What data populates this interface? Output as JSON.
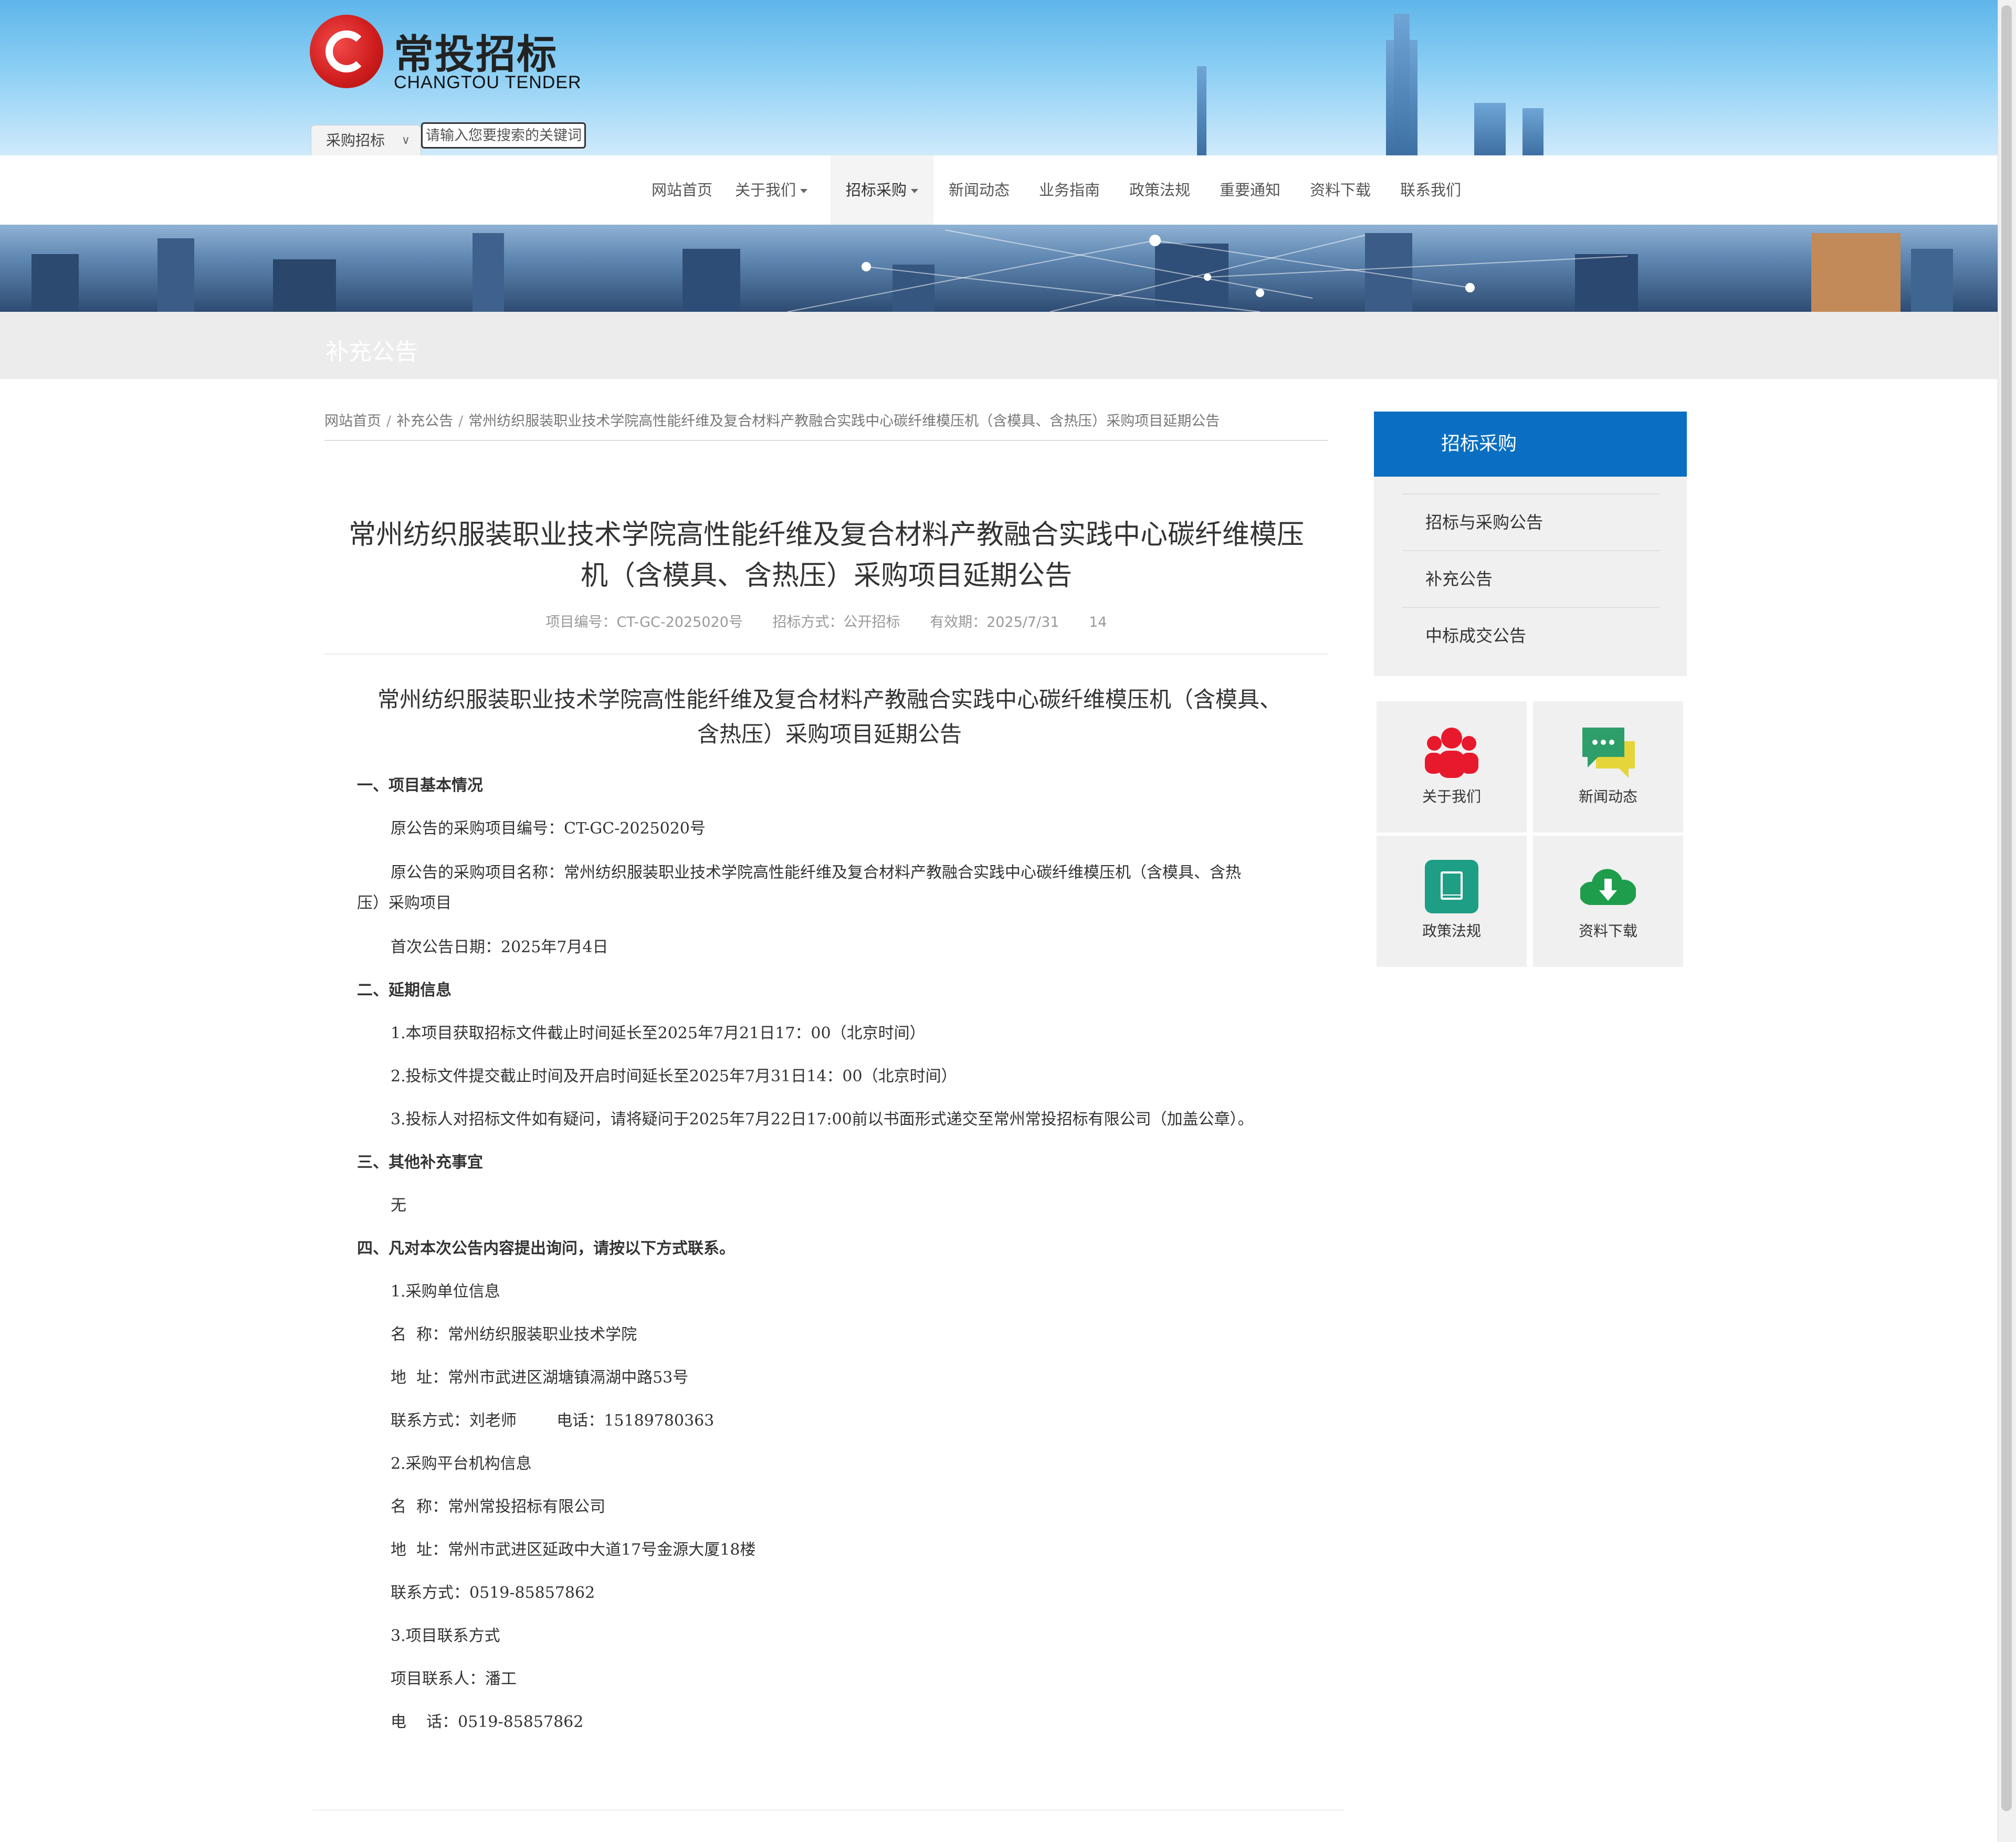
{
  "logo": {
    "cn": "常投招标",
    "en": "CHANGTOU TENDER"
  },
  "search": {
    "category": "采购招标",
    "placeholder": "请输入您要搜索的关键词"
  },
  "nav": {
    "items": [
      "网站首页",
      "关于我们",
      "招标采购",
      "新闻动态",
      "业务指南",
      "政策法规",
      "重要通知",
      "资料下载",
      "联系我们"
    ]
  },
  "page_title": "补充公告",
  "breadcrumb": [
    "网站首页",
    "补充公告",
    "常州纺织服装职业技术学院高性能纤维及复合材料产教融合实践中心碳纤维模压机（含模具、含热压）采购项目延期公告"
  ],
  "article": {
    "title_line1": "常州纺织服装职业技术学院高性能纤维及复合材料产教融合实践中心碳纤维模压",
    "title_line2": "机（含模具、含热压）采购项目延期公告",
    "meta": {
      "code": "项目编号：CT-GC-2025020号",
      "method": "招标方式：公开招标",
      "valid": "有效期：2025/7/31",
      "views": "14"
    },
    "doc_title_line1": "常州纺织服装职业技术学院高性能纤维及复合材料产教融合实践中心碳纤维模压机（含模具、",
    "doc_title_line2": "含热压）采购项目延期公告",
    "s1": "一、项目基本情况",
    "s1_p1": "原公告的采购项目编号：CT-GC-2025020号",
    "s1_p2a": "原公告的采购项目名称：常州纺织服装职业技术学院高性能纤维及复合材料产教融合实践中心碳纤维模压机（含模具、含热",
    "s1_p2b": "压）采购项目",
    "s1_p3": "首次公告日期：2025年7月4日",
    "s2": "二、延期信息",
    "s2_p1": "1.本项目获取招标文件截止时间延长至2025年7月21日17：00（北京时间）",
    "s2_p2": "2.投标文件提交截止时间及开启时间延长至2025年7月31日14：00（北京时间）",
    "s2_p3": "3.投标人对招标文件如有疑问，请将疑问于2025年7月22日17:00前以书面形式递交至常州常投招标有限公司（加盖公章）。",
    "s3": "三、其他补充事宜",
    "s3_p1": "无",
    "s4": "四、凡对本次公告内容提出询问，请按以下方式联系。",
    "c1": "1.采购单位信息",
    "c1_name": "名  称：常州纺织服装职业技术学院",
    "c1_addr": "地  址：常州市武进区湖塘镇滆湖中路53号",
    "c1_contact": "联系方式：刘老师        电话：15189780363",
    "c2": "2.采购平台机构信息",
    "c2_name": "名  称：常州常投招标有限公司",
    "c2_addr": "地  址：常州市武进区延政中大道17号金源大厦18楼",
    "c2_contact": "联系方式：0519-85857862",
    "c3": "3.项目联系方式",
    "c3_person": "项目联系人：潘工",
    "c3_phone": "电    话：0519-85857862"
  },
  "sidebar": {
    "heading": "招标采购",
    "items": [
      "招标与采购公告",
      "补充公告",
      "中标成交公告"
    ],
    "tiles": [
      {
        "label": "关于我们",
        "icon": "users-icon",
        "color": "#e8192c"
      },
      {
        "label": "新闻动态",
        "icon": "chat-icon",
        "color": "#2e9e6a"
      },
      {
        "label": "政策法规",
        "icon": "book-icon",
        "color": "#1f9e86"
      },
      {
        "label": "资料下载",
        "icon": "cloud-download-icon",
        "color": "#1e9e4c"
      }
    ]
  }
}
